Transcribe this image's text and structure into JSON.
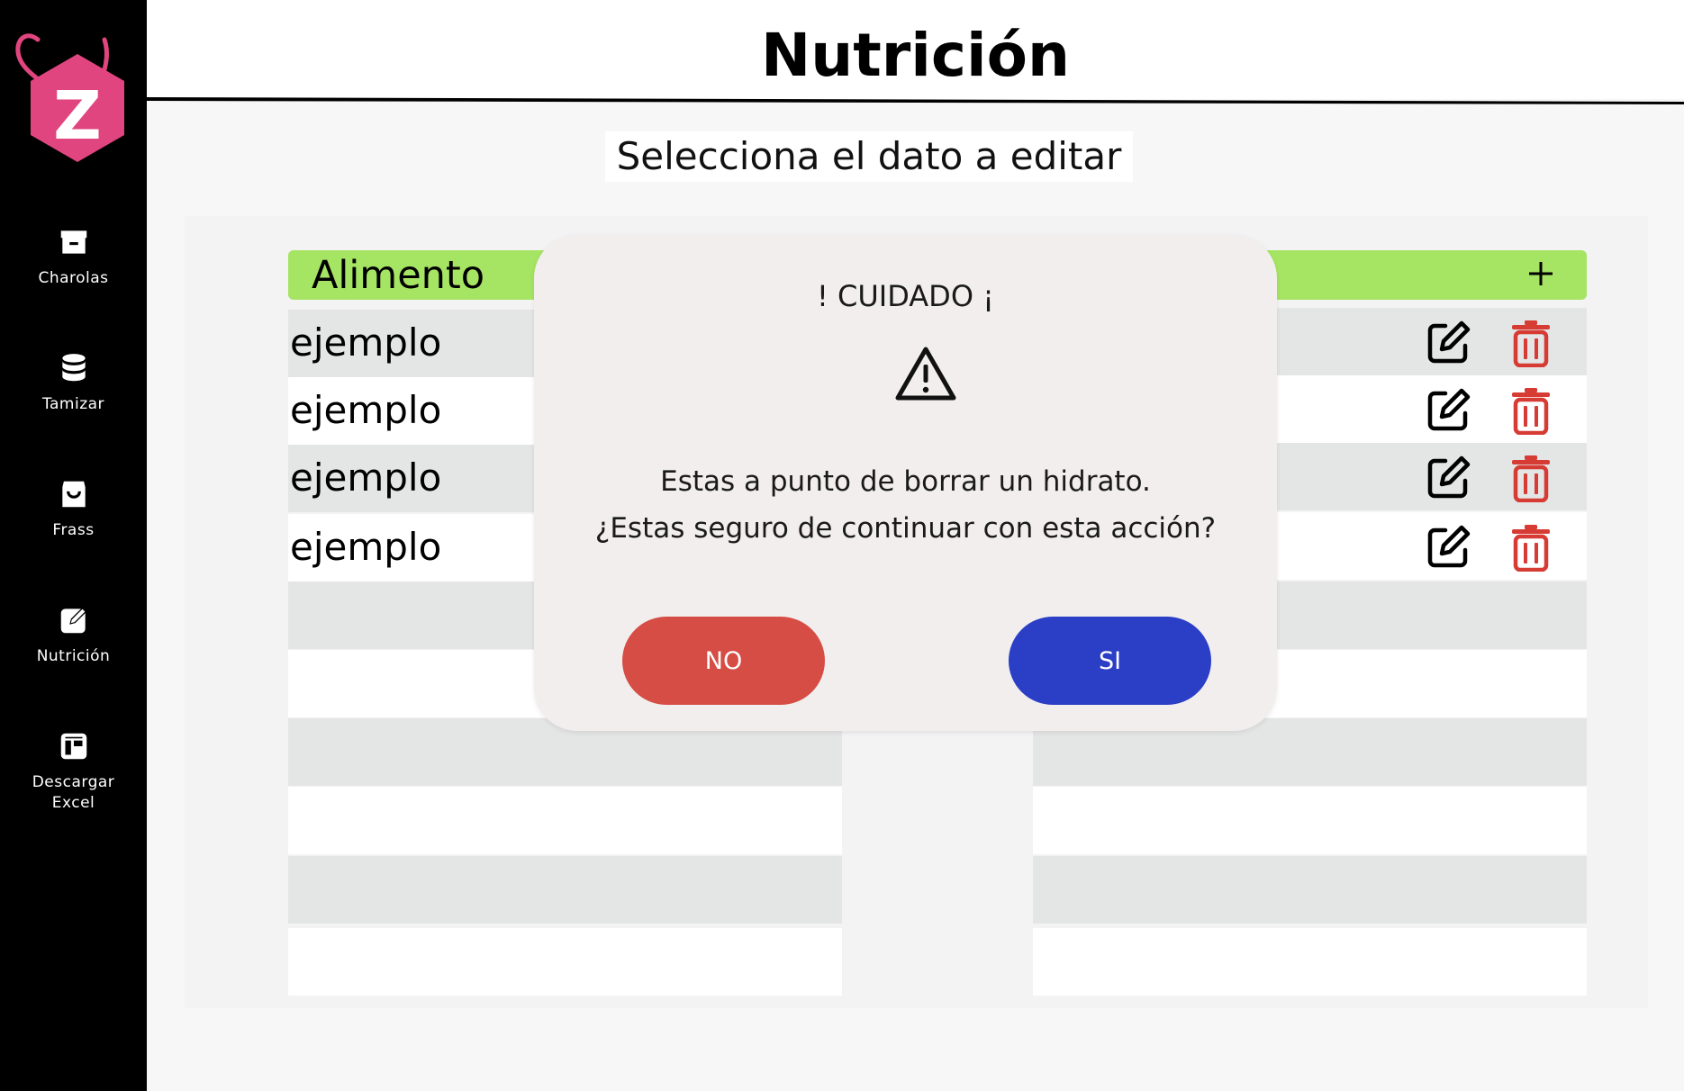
{
  "page": {
    "title": "Nutrición",
    "subtitle": "Selecciona el dato a editar"
  },
  "sidebar": {
    "logo_letter": "Z",
    "items": [
      {
        "label": "Charolas",
        "icon": "archive-icon"
      },
      {
        "label": "Tamizar",
        "icon": "database-icon"
      },
      {
        "label": "Frass",
        "icon": "shopping-bag-icon"
      },
      {
        "label": "Nutrición",
        "icon": "edit-square-icon"
      },
      {
        "label": "Descargar\nExcel",
        "icon": "layout-icon"
      }
    ]
  },
  "tables": [
    {
      "header": "Alimento",
      "rows": [
        "ejemplo",
        "ejemplo",
        "ejemplo",
        "ejemplo",
        "",
        "",
        "",
        "",
        "",
        ""
      ]
    },
    {
      "header": "",
      "rows": [
        "",
        "",
        "",
        "",
        "",
        "",
        "",
        "",
        "",
        ""
      ]
    }
  ],
  "modal": {
    "title": "! CUIDADO ¡",
    "message_line1": "Estas a punto de borrar un hidrato.",
    "message_line2": "¿Estas seguro de continuar con esta acción?",
    "no_label": "NO",
    "si_label": "SI"
  },
  "colors": {
    "header_green": "#a6e463",
    "no_red": "#d64d45",
    "si_blue": "#2a3ec6",
    "logo_pink": "#e0457f",
    "trash_red": "#d63b34"
  }
}
